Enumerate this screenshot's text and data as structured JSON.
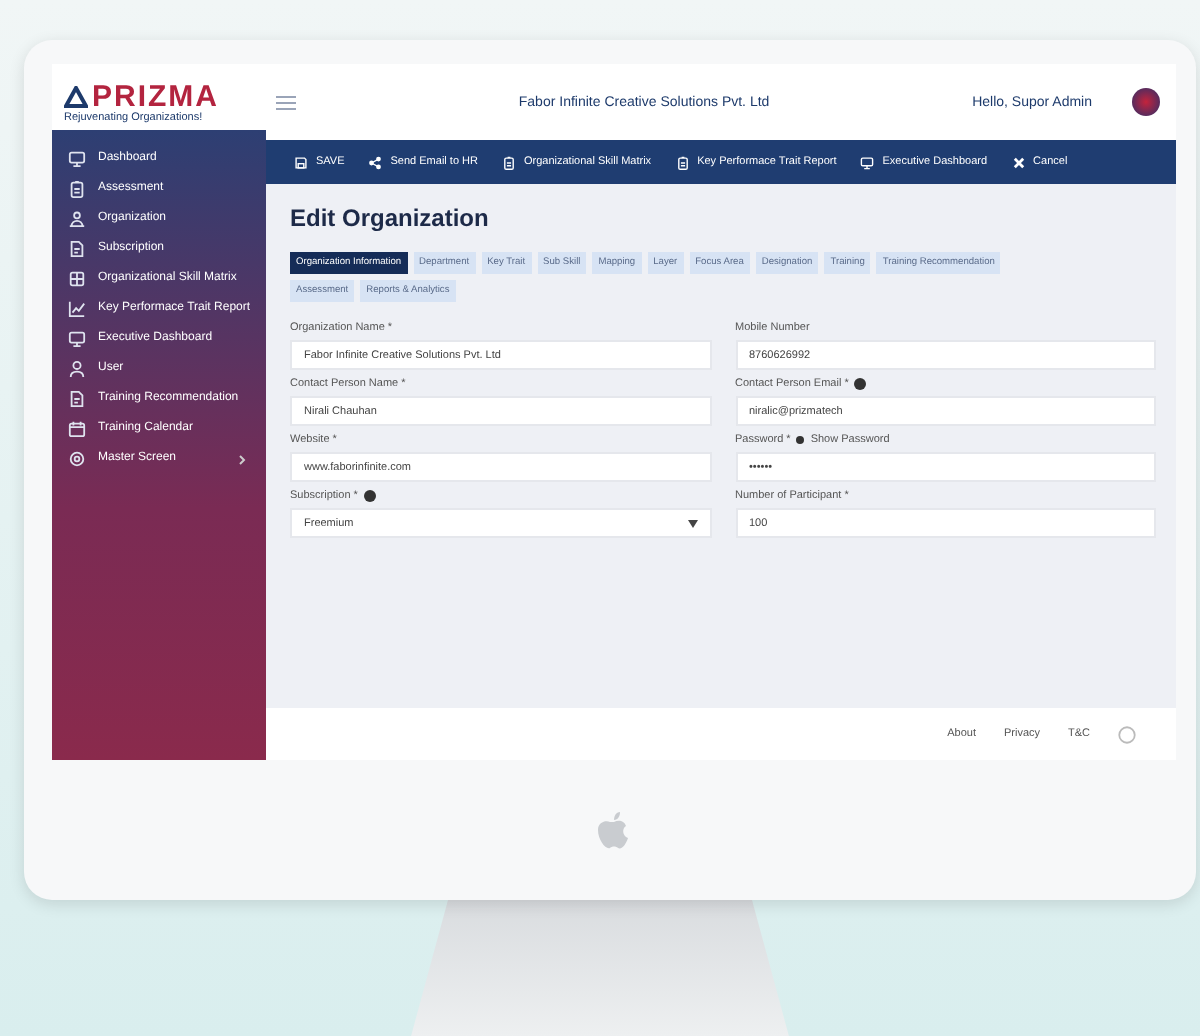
{
  "brand": {
    "name": "PRIZMA",
    "tagline": "Rejuvenating Organizations!"
  },
  "header": {
    "title": "Fabor Infinite Creative Solutions Pvt. Ltd",
    "greeting": "Hello, Supor Admin"
  },
  "sidebar": {
    "items": [
      {
        "label": "Dashboard",
        "expandable": false
      },
      {
        "label": "Assessment",
        "expandable": false
      },
      {
        "label": "Organization",
        "expandable": false
      },
      {
        "label": "Subscription",
        "expandable": false
      },
      {
        "label": "Organizational Skill Matrix",
        "expandable": false
      },
      {
        "label": "Key Performace Trait Report",
        "expandable": false
      },
      {
        "label": "Executive Dashboard",
        "expandable": false
      },
      {
        "label": "User",
        "expandable": false
      },
      {
        "label": "Training Recommendation",
        "expandable": false
      },
      {
        "label": "Training Calendar",
        "expandable": false
      },
      {
        "label": "Master Screen",
        "expandable": true
      }
    ]
  },
  "toolbar": [
    {
      "label": "SAVE"
    },
    {
      "label": "Send Email to HR"
    },
    {
      "label": "Organizational Skill Matrix"
    },
    {
      "label": "Key Performace Trait Report"
    },
    {
      "label": "Executive Dashboard"
    },
    {
      "label": "Cancel"
    }
  ],
  "page_title": "Edit Organization",
  "tabs": [
    {
      "label": "Organization Information",
      "selected": true
    },
    {
      "label": "Department",
      "selected": false
    },
    {
      "label": "Key Trait",
      "selected": false
    },
    {
      "label": "Sub Skill",
      "selected": false
    },
    {
      "label": "Mapping",
      "selected": false
    },
    {
      "label": "Layer",
      "selected": false
    },
    {
      "label": "Focus Area",
      "selected": false
    },
    {
      "label": "Designation",
      "selected": false
    },
    {
      "label": "Training",
      "selected": false
    },
    {
      "label": "Training Recommendation",
      "selected": false
    },
    {
      "label": "Assessment",
      "selected": false
    },
    {
      "label": "Reports & Analytics",
      "selected": false
    }
  ],
  "fields": [
    {
      "label": "Organization Name *",
      "value": "Fabor Infinite Creative Solutions Pvt. Ltd",
      "kind": "text",
      "info": false
    },
    {
      "label": "Mobile Number",
      "value": "8760626992",
      "kind": "text",
      "info": false
    },
    {
      "label": "Contact Person Name *",
      "value": "Nirali Chauhan",
      "kind": "text",
      "info": false
    },
    {
      "label": "Contact Person Email *",
      "value": "niralic@prizmatech",
      "kind": "text",
      "info": true
    },
    {
      "label": "Website *",
      "value": "www.faborinfinite.com",
      "kind": "text",
      "info": false
    },
    {
      "label": "Password *",
      "value": "••••••",
      "kind": "password",
      "info": false,
      "toggle": "Show Password"
    },
    {
      "label": "Subscription *",
      "value": "Freemium",
      "kind": "select",
      "info": true
    },
    {
      "label": "Number of Participant *",
      "value": "100",
      "kind": "text",
      "info": false
    }
  ],
  "footer": {
    "links": [
      "About",
      "Privacy",
      "T&C"
    ]
  }
}
